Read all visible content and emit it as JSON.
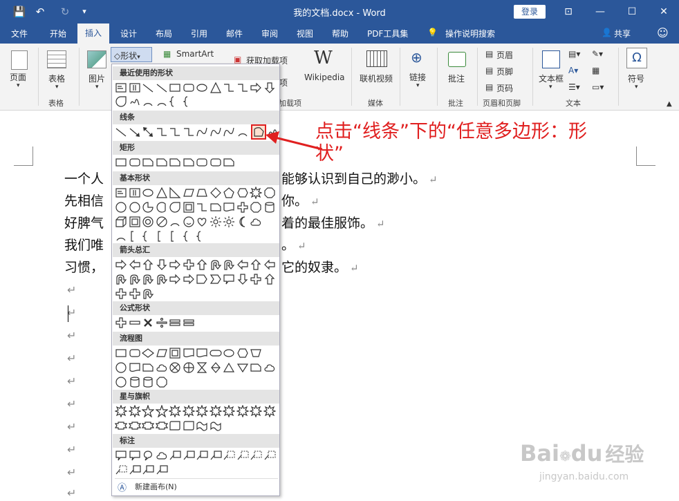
{
  "titlebar": {
    "doc_title": "我的文档.docx - Word",
    "login": "登录"
  },
  "tabs": [
    "文件",
    "开始",
    "插入",
    "设计",
    "布局",
    "引用",
    "邮件",
    "审阅",
    "视图",
    "帮助",
    "PDF工具集",
    "操作说明搜索",
    "共享"
  ],
  "ribbon": {
    "page": "页面",
    "table": "表格",
    "picture": "图片",
    "shapes": "形状",
    "smartart": "SmartArt",
    "get_addins": "获取加载项",
    "wikipedia": "Wikipedia",
    "online_video": "联机视频",
    "link": "链接",
    "comment": "批注",
    "header": "页眉",
    "footer": "页脚",
    "page_number": "页码",
    "textbox": "文本框",
    "symbol": "符号",
    "addins_partial": "加载项",
    "addins_partial2": "项",
    "groups": {
      "table": "表格",
      "media": "媒体",
      "comment": "批注",
      "header_footer": "页眉和页脚",
      "text": "文本"
    },
    "wiki_logo": "W",
    "symbol_glyph": "Ω"
  },
  "document": {
    "lines": [
      {
        "left": "一个人",
        "right": "能够认识到自己的渺小。"
      },
      {
        "left": "先相信",
        "right": "你。"
      },
      {
        "left": "好脾气",
        "right": "着的最佳服饰。"
      },
      {
        "left": "我们唯",
        "right": "。"
      },
      {
        "left": "习惯，",
        "right": "它的奴隶。"
      }
    ],
    "para_mark": "↵"
  },
  "shapes_panel": {
    "sections": [
      "最近使用的形状",
      "线条",
      "矩形",
      "基本形状",
      "箭头总汇",
      "公式形状",
      "流程图",
      "星与旗帜",
      "标注"
    ],
    "new_canvas": "新建画布(N)"
  },
  "annotation": {
    "line1": "点击“线条”下的“任意多边形：形",
    "line2": "状”"
  },
  "watermark": {
    "brand": "Bai",
    "brand2": "du",
    "brand_cn": "经验",
    "url": "jingyan.baidu.com"
  },
  "colors": {
    "accent": "#2b579a",
    "annotation": "#e02020"
  }
}
